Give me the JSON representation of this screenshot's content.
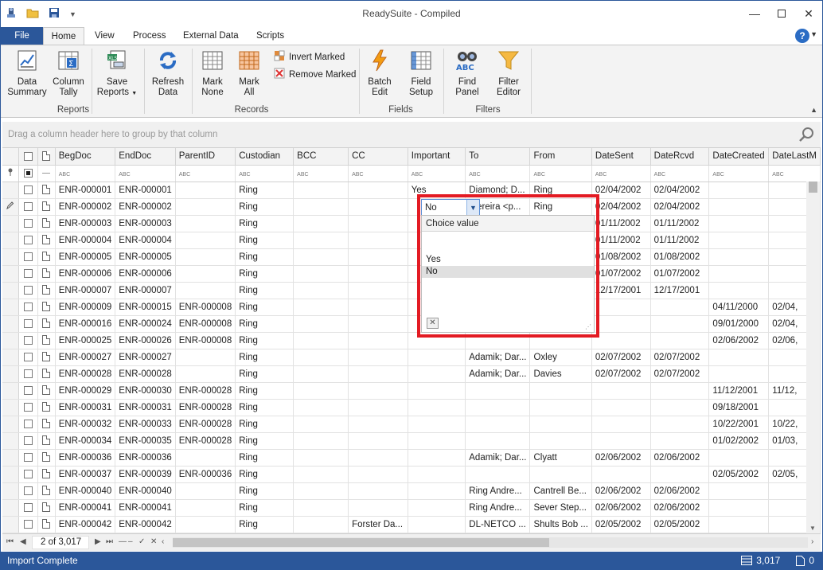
{
  "window": {
    "title": "ReadySuite - Compiled"
  },
  "tabs": {
    "file": "File",
    "items": [
      "Home",
      "View",
      "Process",
      "External Data",
      "Scripts"
    ]
  },
  "ribbon": {
    "reports": {
      "label": "Reports",
      "data_summary": [
        "Data",
        "Summary"
      ],
      "column_tally": [
        "Column",
        "Tally"
      ],
      "save_reports": [
        "Save",
        "Reports"
      ]
    },
    "records": {
      "label": "Records",
      "refresh_data": [
        "Refresh",
        "Data"
      ],
      "mark_none": [
        "Mark",
        "None"
      ],
      "mark_all": [
        "Mark",
        "All"
      ],
      "invert_marked": "Invert Marked",
      "remove_marked": "Remove Marked"
    },
    "fields": {
      "label": "Fields",
      "batch_edit": [
        "Batch",
        "Edit"
      ],
      "field_setup": [
        "Field",
        "Setup"
      ]
    },
    "filters": {
      "label": "Filters",
      "find_panel": [
        "Find",
        "Panel"
      ],
      "filter_editor": [
        "Filter",
        "Editor"
      ]
    }
  },
  "group_panel": {
    "hint": "Drag a column header here to group by that column"
  },
  "grid": {
    "columns": [
      "BegDoc",
      "EndDoc",
      "ParentID",
      "Custodian",
      "BCC",
      "CC",
      "Important",
      "To",
      "From",
      "DateSent",
      "DateRcvd",
      "DateCreated",
      "DateLastM"
    ],
    "filter_icon_text": "ABC",
    "rows": [
      [
        "ENR-000001",
        "ENR-000001",
        "",
        "Ring",
        "",
        "",
        "Yes",
        "Diamond; D...",
        "Ring",
        "02/04/2002",
        "02/04/2002",
        "",
        ""
      ],
      [
        "ENR-000002",
        "ENR-000002",
        "",
        "Ring",
        "",
        "",
        "",
        "'Pereira <p...",
        "Ring",
        "02/04/2002",
        "02/04/2002",
        "",
        ""
      ],
      [
        "ENR-000003",
        "ENR-000003",
        "",
        "Ring",
        "",
        "",
        "",
        "",
        "",
        "01/11/2002",
        "01/11/2002",
        "",
        ""
      ],
      [
        "ENR-000004",
        "ENR-000004",
        "",
        "Ring",
        "",
        "",
        "",
        "",
        "",
        "01/11/2002",
        "01/11/2002",
        "",
        ""
      ],
      [
        "ENR-000005",
        "ENR-000005",
        "",
        "Ring",
        "",
        "",
        "",
        "",
        "",
        "01/08/2002",
        "01/08/2002",
        "",
        ""
      ],
      [
        "ENR-000006",
        "ENR-000006",
        "",
        "Ring",
        "",
        "",
        "",
        "",
        "",
        "01/07/2002",
        "01/07/2002",
        "",
        ""
      ],
      [
        "ENR-000007",
        "ENR-000007",
        "",
        "Ring",
        "",
        "",
        "",
        "",
        "",
        "12/17/2001",
        "12/17/2001",
        "",
        ""
      ],
      [
        "ENR-000009",
        "ENR-000015",
        "ENR-000008",
        "Ring",
        "",
        "",
        "",
        "",
        "",
        "",
        "",
        "04/11/2000",
        "02/04,"
      ],
      [
        "ENR-000016",
        "ENR-000024",
        "ENR-000008",
        "Ring",
        "",
        "",
        "",
        "",
        "",
        "",
        "",
        "09/01/2000",
        "02/04,"
      ],
      [
        "ENR-000025",
        "ENR-000026",
        "ENR-000008",
        "Ring",
        "",
        "",
        "",
        "",
        "",
        "",
        "",
        "02/06/2002",
        "02/06,"
      ],
      [
        "ENR-000027",
        "ENR-000027",
        "",
        "Ring",
        "",
        "",
        "",
        "Adamik; Dar...",
        "Oxley",
        "02/07/2002",
        "02/07/2002",
        "",
        ""
      ],
      [
        "ENR-000028",
        "ENR-000028",
        "",
        "Ring",
        "",
        "",
        "",
        "Adamik; Dar...",
        "Davies",
        "02/07/2002",
        "02/07/2002",
        "",
        ""
      ],
      [
        "ENR-000029",
        "ENR-000030",
        "ENR-000028",
        "Ring",
        "",
        "",
        "",
        "",
        "",
        "",
        "",
        "11/12/2001",
        "11/12,"
      ],
      [
        "ENR-000031",
        "ENR-000031",
        "ENR-000028",
        "Ring",
        "",
        "",
        "",
        "",
        "",
        "",
        "",
        "09/18/2001",
        ""
      ],
      [
        "ENR-000032",
        "ENR-000033",
        "ENR-000028",
        "Ring",
        "",
        "",
        "",
        "",
        "",
        "",
        "",
        "10/22/2001",
        "10/22,"
      ],
      [
        "ENR-000034",
        "ENR-000035",
        "ENR-000028",
        "Ring",
        "",
        "",
        "",
        "",
        "",
        "",
        "",
        "01/02/2002",
        "01/03,"
      ],
      [
        "ENR-000036",
        "ENR-000036",
        "",
        "Ring",
        "",
        "",
        "",
        "Adamik; Dar...",
        "Clyatt",
        "02/06/2002",
        "02/06/2002",
        "",
        ""
      ],
      [
        "ENR-000037",
        "ENR-000039",
        "ENR-000036",
        "Ring",
        "",
        "",
        "",
        "",
        "",
        "",
        "",
        "02/05/2002",
        "02/05,"
      ],
      [
        "ENR-000040",
        "ENR-000040",
        "",
        "Ring",
        "",
        "",
        "",
        "Ring Andre...",
        "Cantrell Be...",
        "02/06/2002",
        "02/06/2002",
        "",
        ""
      ],
      [
        "ENR-000041",
        "ENR-000041",
        "",
        "Ring",
        "",
        "",
        "",
        "Ring Andre...",
        "Sever Step...",
        "02/06/2002",
        "02/06/2002",
        "",
        ""
      ],
      [
        "ENR-000042",
        "ENR-000042",
        "",
        "Ring",
        "",
        "Forster Da...",
        "",
        "DL-NETCO ...",
        "Shults Bob ...",
        "02/05/2002",
        "02/05/2002",
        "",
        ""
      ]
    ]
  },
  "editor": {
    "value": "No",
    "popup_header": "Choice value",
    "options": [
      "",
      "Yes",
      "No"
    ],
    "selected": "No"
  },
  "navigator": {
    "position": "2 of 3,017"
  },
  "status": {
    "message": "Import  Complete",
    "record_count": "3,017",
    "file_count": "0"
  }
}
